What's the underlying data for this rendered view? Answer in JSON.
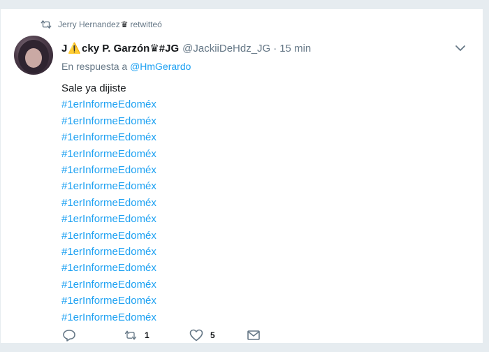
{
  "retweet_context": {
    "user": "Jerry Hernandez",
    "crown": "♛",
    "suffix": "retwitteó"
  },
  "tweet": {
    "name_start": "J",
    "name_warn": "⚠️",
    "name_end": "cky P. Garzón",
    "name_crown": "♛",
    "name_tag": "#JG",
    "handle": "@JackiiDeHdz_JG",
    "separator": "·",
    "time": "15 min",
    "reply_prefix": "En respuesta a",
    "reply_user": "@HmGerardo",
    "text": "Sale ya dijiste",
    "hashtags": [
      "#1erInformeEdoméx",
      "#1erInformeEdoméx",
      "#1erInformeEdoméx",
      "#1erInformeEdoméx",
      "#1erInformeEdoméx",
      "#1erInformeEdoméx",
      "#1erInformeEdoméx",
      "#1erInformeEdoméx",
      "#1erInformeEdoméx",
      "#1erInformeEdoméx",
      "#1erInformeEdoméx",
      "#1erInformeEdoméx",
      "#1erInformeEdoméx",
      "#1erInformeEdoméx"
    ]
  },
  "actions": {
    "reply_icon": "reply-icon",
    "retweet_icon": "retweet-icon",
    "retweet_count": "1",
    "like_icon": "heart-icon",
    "like_count": "5",
    "dm_icon": "envelope-icon"
  },
  "colors": {
    "link": "#1da1f2",
    "muted": "#657786",
    "text": "#14171a"
  }
}
